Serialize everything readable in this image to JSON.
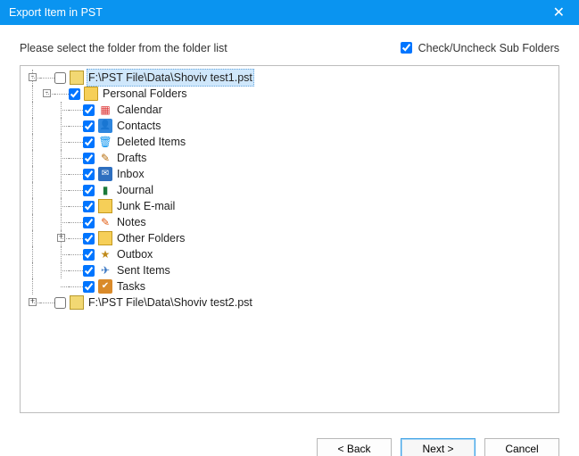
{
  "window": {
    "title": "Export Item in PST"
  },
  "prompt": "Please select the folder from the folder list",
  "checkAll": {
    "label": "Check/Uncheck Sub Folders",
    "checked": true
  },
  "roots": [
    {
      "label": "F:\\PST File\\Data\\Shoviv test1.pst",
      "checked": false,
      "expanded": true,
      "selected": true,
      "icon": "pst",
      "children": [
        {
          "label": "Personal Folders",
          "checked": true,
          "expanded": true,
          "icon": "pfolder",
          "children": [
            {
              "label": "Calendar",
              "checked": true,
              "icon": "cal"
            },
            {
              "label": "Contacts",
              "checked": true,
              "icon": "contacts"
            },
            {
              "label": "Deleted Items",
              "checked": true,
              "icon": "del"
            },
            {
              "label": "Drafts",
              "checked": true,
              "icon": "drafts"
            },
            {
              "label": "Inbox",
              "checked": true,
              "icon": "inbox"
            },
            {
              "label": "Journal",
              "checked": true,
              "icon": "journal"
            },
            {
              "label": "Junk E-mail",
              "checked": true,
              "icon": "junk"
            },
            {
              "label": "Notes",
              "checked": true,
              "icon": "notes"
            },
            {
              "label": "Other Folders",
              "checked": true,
              "icon": "other",
              "expandable": true
            },
            {
              "label": "Outbox",
              "checked": true,
              "icon": "outbox"
            },
            {
              "label": "Sent Items",
              "checked": true,
              "icon": "sent"
            },
            {
              "label": "Tasks",
              "checked": true,
              "icon": "tasks"
            }
          ]
        }
      ]
    },
    {
      "label": "F:\\PST File\\Data\\Shoviv test2.pst",
      "checked": false,
      "expanded": false,
      "expandable": true,
      "icon": "pst"
    }
  ],
  "buttons": {
    "back": "< Back",
    "next": "Next >",
    "cancel": "Cancel"
  }
}
